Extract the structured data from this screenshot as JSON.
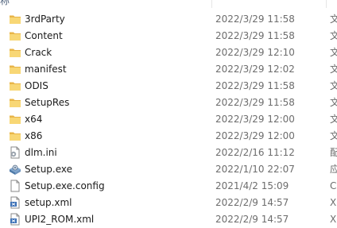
{
  "header": {
    "name_label": "称",
    "date_label": "",
    "type_label": ""
  },
  "files": [
    {
      "name": "3rdParty",
      "date": "2022/3/29 11:58",
      "type": "文",
      "icon": "folder-icon"
    },
    {
      "name": "Content",
      "date": "2022/3/29 11:58",
      "type": "文",
      "icon": "folder-icon"
    },
    {
      "name": "Crack",
      "date": "2022/3/29 12:10",
      "type": "文",
      "icon": "folder-icon"
    },
    {
      "name": "manifest",
      "date": "2022/3/29 12:02",
      "type": "文",
      "icon": "folder-icon"
    },
    {
      "name": "ODIS",
      "date": "2022/3/29 11:58",
      "type": "文",
      "icon": "folder-icon"
    },
    {
      "name": "SetupRes",
      "date": "2022/3/29 11:58",
      "type": "文",
      "icon": "folder-icon"
    },
    {
      "name": "x64",
      "date": "2022/3/29 12:00",
      "type": "文",
      "icon": "folder-icon"
    },
    {
      "name": "x86",
      "date": "2022/3/29 12:00",
      "type": "文",
      "icon": "folder-icon"
    },
    {
      "name": "dlm.ini",
      "date": "2022/2/16 11:12",
      "type": "配",
      "icon": "ini-settings-icon"
    },
    {
      "name": "Setup.exe",
      "date": "2022/1/10 22:07",
      "type": "应",
      "icon": "installer-exe-icon"
    },
    {
      "name": "Setup.exe.config",
      "date": "2021/4/2 15:09",
      "type": "C",
      "icon": "config-file-icon"
    },
    {
      "name": "setup.xml",
      "date": "2022/2/9 14:57",
      "type": "X",
      "icon": "xml-file-icon"
    },
    {
      "name": "UPI2_ROM.xml",
      "date": "2022/2/9 14:57",
      "type": "X",
      "icon": "xml-file-icon"
    }
  ],
  "colors": {
    "folder": "#f8d775",
    "folder_dark": "#e8b548",
    "text": "#1b1b1b",
    "meta_text": "#6d6d6d"
  }
}
